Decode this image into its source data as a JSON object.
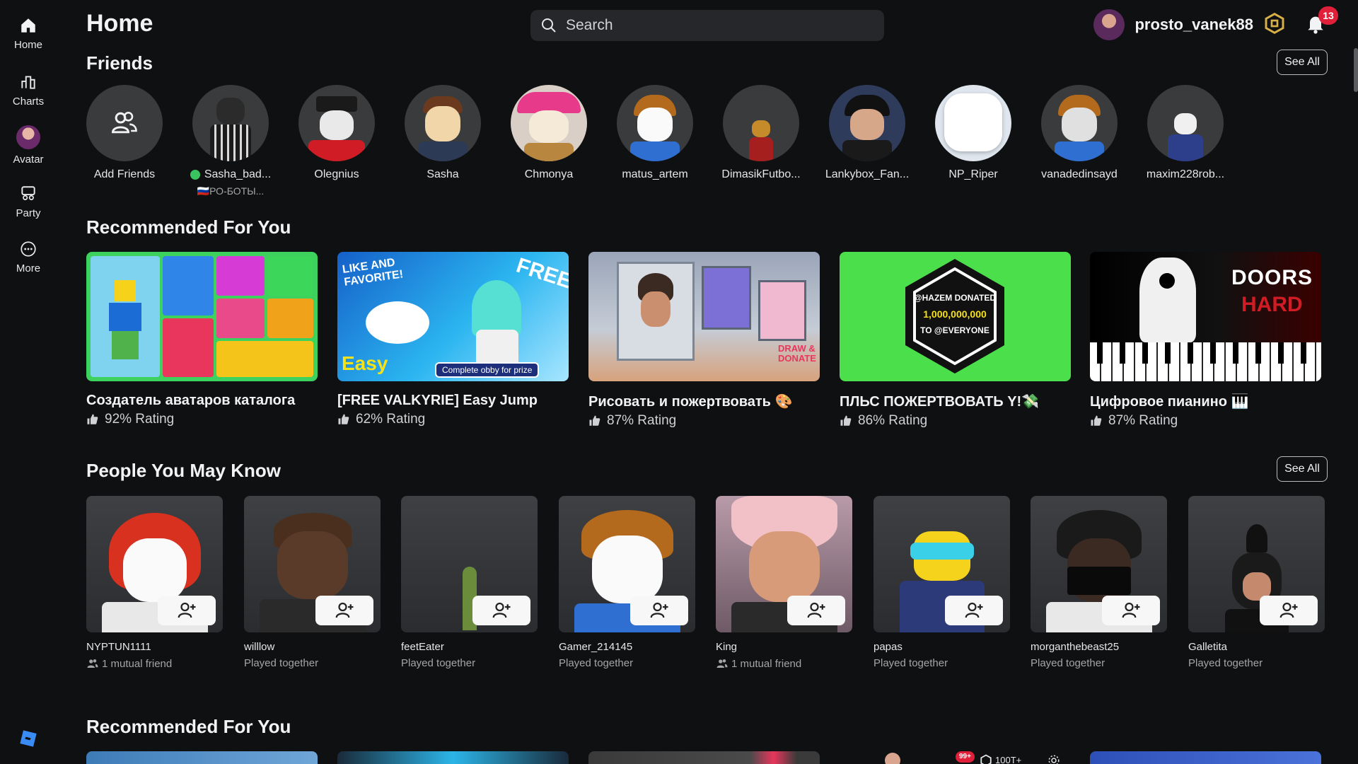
{
  "sidebar": {
    "items": [
      {
        "label": "Home",
        "icon": "home-icon"
      },
      {
        "label": "Charts",
        "icon": "charts-icon"
      },
      {
        "label": "Avatar",
        "icon": "avatar-icon"
      },
      {
        "label": "Party",
        "icon": "party-icon"
      },
      {
        "label": "More",
        "icon": "more-icon"
      }
    ]
  },
  "header": {
    "title": "Home",
    "search_placeholder": "Search",
    "username": "prosto_vanek88",
    "notification_count": "13"
  },
  "friends": {
    "title": "Friends",
    "see_all": "See All",
    "add_label": "Add Friends",
    "items": [
      {
        "name": "Sasha_bad...",
        "online": true,
        "status": "🇷🇺РО-БОТЫ..."
      },
      {
        "name": "Olegnius"
      },
      {
        "name": "Sasha"
      },
      {
        "name": "Chmonya"
      },
      {
        "name": "matus_artem"
      },
      {
        "name": "DimasikFutbo..."
      },
      {
        "name": "Lankybox_Fan..."
      },
      {
        "name": "NP_Riper"
      },
      {
        "name": "vanadedinsayd"
      },
      {
        "name": "maxim228rob..."
      }
    ]
  },
  "recommended": {
    "title": "Recommended For You",
    "games": [
      {
        "title": "Создатель аватаров каталога",
        "rating": "92% Rating"
      },
      {
        "title": "[FREE VALKYRIE] Easy Jump",
        "rating": "62% Rating",
        "thumb_text": "LIKE AND FAVORITE!",
        "thumb_free": "FREE",
        "thumb_easy": "Easy",
        "thumb_prize": "Complete obby for prize"
      },
      {
        "title": "Рисовать и пожертвовать 🎨",
        "rating": "87% Rating",
        "thumb_draw": "DRAW & DONATE"
      },
      {
        "title": "ПЛЬС ПОЖЕРТВОВАТЬ Y!💸",
        "rating": "86% Rating",
        "thumb_line1": "@HAZEM DONATED",
        "thumb_line2": "1,000,000,000",
        "thumb_line3": "TO @EVERYONE"
      },
      {
        "title": "Цифровое пианино 🎹",
        "rating": "87% Rating",
        "thumb_doors": "DOORS",
        "thumb_hard": "HARD"
      }
    ]
  },
  "people": {
    "title": "People You May Know",
    "see_all": "See All",
    "items": [
      {
        "name": "NYPTUN1111",
        "sub": "1 mutual friend",
        "mutual": true
      },
      {
        "name": "willlow",
        "sub": "Played together",
        "mutual": false
      },
      {
        "name": "feetEater",
        "sub": "Played together",
        "mutual": false
      },
      {
        "name": "Gamer_214145",
        "sub": "Played together",
        "mutual": false
      },
      {
        "name": "King",
        "sub": "1 mutual friend",
        "mutual": true
      },
      {
        "name": "papas",
        "sub": "Played together",
        "mutual": false
      },
      {
        "name": "morganthebeast25",
        "sub": "Played together",
        "mutual": false
      },
      {
        "name": "Galletita",
        "sub": "Played together",
        "mutual": false
      }
    ]
  },
  "recommended2": {
    "title": "Recommended For You",
    "thumb_badge": "99+",
    "thumb_robux": "100T+"
  }
}
